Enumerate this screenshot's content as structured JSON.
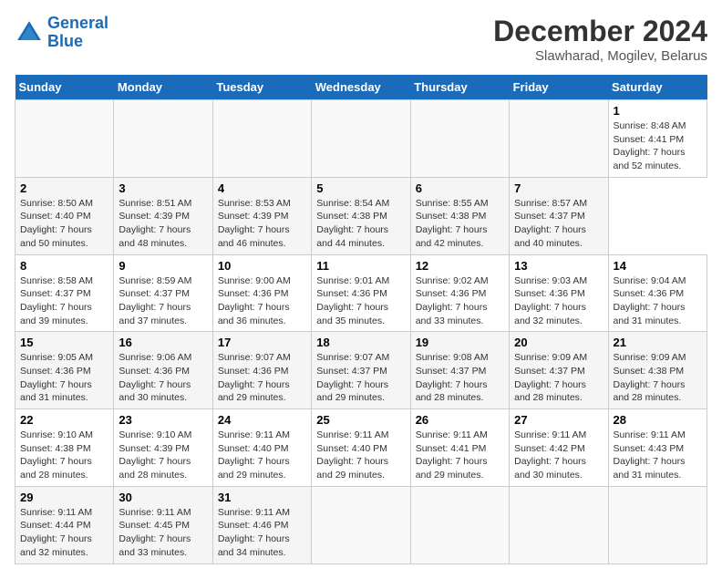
{
  "header": {
    "logo_line1": "General",
    "logo_line2": "Blue",
    "title": "December 2024",
    "subtitle": "Slawharad, Mogilev, Belarus"
  },
  "calendar": {
    "days_of_week": [
      "Sunday",
      "Monday",
      "Tuesday",
      "Wednesday",
      "Thursday",
      "Friday",
      "Saturday"
    ],
    "weeks": [
      [
        {
          "day": "",
          "info": ""
        },
        {
          "day": "",
          "info": ""
        },
        {
          "day": "",
          "info": ""
        },
        {
          "day": "",
          "info": ""
        },
        {
          "day": "",
          "info": ""
        },
        {
          "day": "",
          "info": ""
        },
        {
          "day": "1",
          "info": "Sunrise: 8:48 AM\nSunset: 4:41 PM\nDaylight: 7 hours\nand 52 minutes."
        }
      ],
      [
        {
          "day": "2",
          "info": "Sunrise: 8:50 AM\nSunset: 4:40 PM\nDaylight: 7 hours\nand 50 minutes."
        },
        {
          "day": "3",
          "info": "Sunrise: 8:51 AM\nSunset: 4:39 PM\nDaylight: 7 hours\nand 48 minutes."
        },
        {
          "day": "4",
          "info": "Sunrise: 8:53 AM\nSunset: 4:39 PM\nDaylight: 7 hours\nand 46 minutes."
        },
        {
          "day": "5",
          "info": "Sunrise: 8:54 AM\nSunset: 4:38 PM\nDaylight: 7 hours\nand 44 minutes."
        },
        {
          "day": "6",
          "info": "Sunrise: 8:55 AM\nSunset: 4:38 PM\nDaylight: 7 hours\nand 42 minutes."
        },
        {
          "day": "7",
          "info": "Sunrise: 8:57 AM\nSunset: 4:37 PM\nDaylight: 7 hours\nand 40 minutes."
        }
      ],
      [
        {
          "day": "8",
          "info": "Sunrise: 8:58 AM\nSunset: 4:37 PM\nDaylight: 7 hours\nand 39 minutes."
        },
        {
          "day": "9",
          "info": "Sunrise: 8:59 AM\nSunset: 4:37 PM\nDaylight: 7 hours\nand 37 minutes."
        },
        {
          "day": "10",
          "info": "Sunrise: 9:00 AM\nSunset: 4:36 PM\nDaylight: 7 hours\nand 36 minutes."
        },
        {
          "day": "11",
          "info": "Sunrise: 9:01 AM\nSunset: 4:36 PM\nDaylight: 7 hours\nand 35 minutes."
        },
        {
          "day": "12",
          "info": "Sunrise: 9:02 AM\nSunset: 4:36 PM\nDaylight: 7 hours\nand 33 minutes."
        },
        {
          "day": "13",
          "info": "Sunrise: 9:03 AM\nSunset: 4:36 PM\nDaylight: 7 hours\nand 32 minutes."
        },
        {
          "day": "14",
          "info": "Sunrise: 9:04 AM\nSunset: 4:36 PM\nDaylight: 7 hours\nand 31 minutes."
        }
      ],
      [
        {
          "day": "15",
          "info": "Sunrise: 9:05 AM\nSunset: 4:36 PM\nDaylight: 7 hours\nand 31 minutes."
        },
        {
          "day": "16",
          "info": "Sunrise: 9:06 AM\nSunset: 4:36 PM\nDaylight: 7 hours\nand 30 minutes."
        },
        {
          "day": "17",
          "info": "Sunrise: 9:07 AM\nSunset: 4:36 PM\nDaylight: 7 hours\nand 29 minutes."
        },
        {
          "day": "18",
          "info": "Sunrise: 9:07 AM\nSunset: 4:37 PM\nDaylight: 7 hours\nand 29 minutes."
        },
        {
          "day": "19",
          "info": "Sunrise: 9:08 AM\nSunset: 4:37 PM\nDaylight: 7 hours\nand 28 minutes."
        },
        {
          "day": "20",
          "info": "Sunrise: 9:09 AM\nSunset: 4:37 PM\nDaylight: 7 hours\nand 28 minutes."
        },
        {
          "day": "21",
          "info": "Sunrise: 9:09 AM\nSunset: 4:38 PM\nDaylight: 7 hours\nand 28 minutes."
        }
      ],
      [
        {
          "day": "22",
          "info": "Sunrise: 9:10 AM\nSunset: 4:38 PM\nDaylight: 7 hours\nand 28 minutes."
        },
        {
          "day": "23",
          "info": "Sunrise: 9:10 AM\nSunset: 4:39 PM\nDaylight: 7 hours\nand 28 minutes."
        },
        {
          "day": "24",
          "info": "Sunrise: 9:11 AM\nSunset: 4:40 PM\nDaylight: 7 hours\nand 29 minutes."
        },
        {
          "day": "25",
          "info": "Sunrise: 9:11 AM\nSunset: 4:40 PM\nDaylight: 7 hours\nand 29 minutes."
        },
        {
          "day": "26",
          "info": "Sunrise: 9:11 AM\nSunset: 4:41 PM\nDaylight: 7 hours\nand 29 minutes."
        },
        {
          "day": "27",
          "info": "Sunrise: 9:11 AM\nSunset: 4:42 PM\nDaylight: 7 hours\nand 30 minutes."
        },
        {
          "day": "28",
          "info": "Sunrise: 9:11 AM\nSunset: 4:43 PM\nDaylight: 7 hours\nand 31 minutes."
        }
      ],
      [
        {
          "day": "29",
          "info": "Sunrise: 9:11 AM\nSunset: 4:44 PM\nDaylight: 7 hours\nand 32 minutes."
        },
        {
          "day": "30",
          "info": "Sunrise: 9:11 AM\nSunset: 4:45 PM\nDaylight: 7 hours\nand 33 minutes."
        },
        {
          "day": "31",
          "info": "Sunrise: 9:11 AM\nSunset: 4:46 PM\nDaylight: 7 hours\nand 34 minutes."
        },
        {
          "day": "",
          "info": ""
        },
        {
          "day": "",
          "info": ""
        },
        {
          "day": "",
          "info": ""
        },
        {
          "day": "",
          "info": ""
        }
      ]
    ]
  }
}
